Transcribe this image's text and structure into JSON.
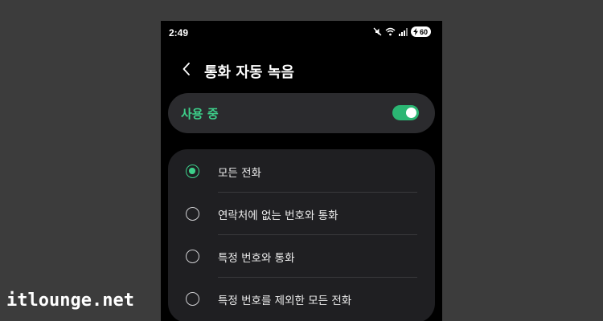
{
  "status_bar": {
    "time": "2:49",
    "battery": "60",
    "icons": [
      "mute-icon",
      "wifi-icon",
      "signal-icon",
      "battery-charging-icon"
    ]
  },
  "header": {
    "back_icon": "chevron-left-icon",
    "title": "통화 자동 녹음"
  },
  "toggle": {
    "label": "사용 중",
    "state": "on",
    "accent_color": "#3dcf8a"
  },
  "options": [
    {
      "label": "모든 전화",
      "selected": true
    },
    {
      "label": "연락처에 없는 번호와 통화",
      "selected": false
    },
    {
      "label": "특정 번호와 통화",
      "selected": false
    },
    {
      "label": "특정 번호를 제외한 모든 전화",
      "selected": false
    }
  ],
  "watermark": "itlounge.net",
  "colors": {
    "background": "#3c3c3c",
    "screen": "#000000",
    "card": "#2b2b2e",
    "accent": "#3dcf8a"
  }
}
